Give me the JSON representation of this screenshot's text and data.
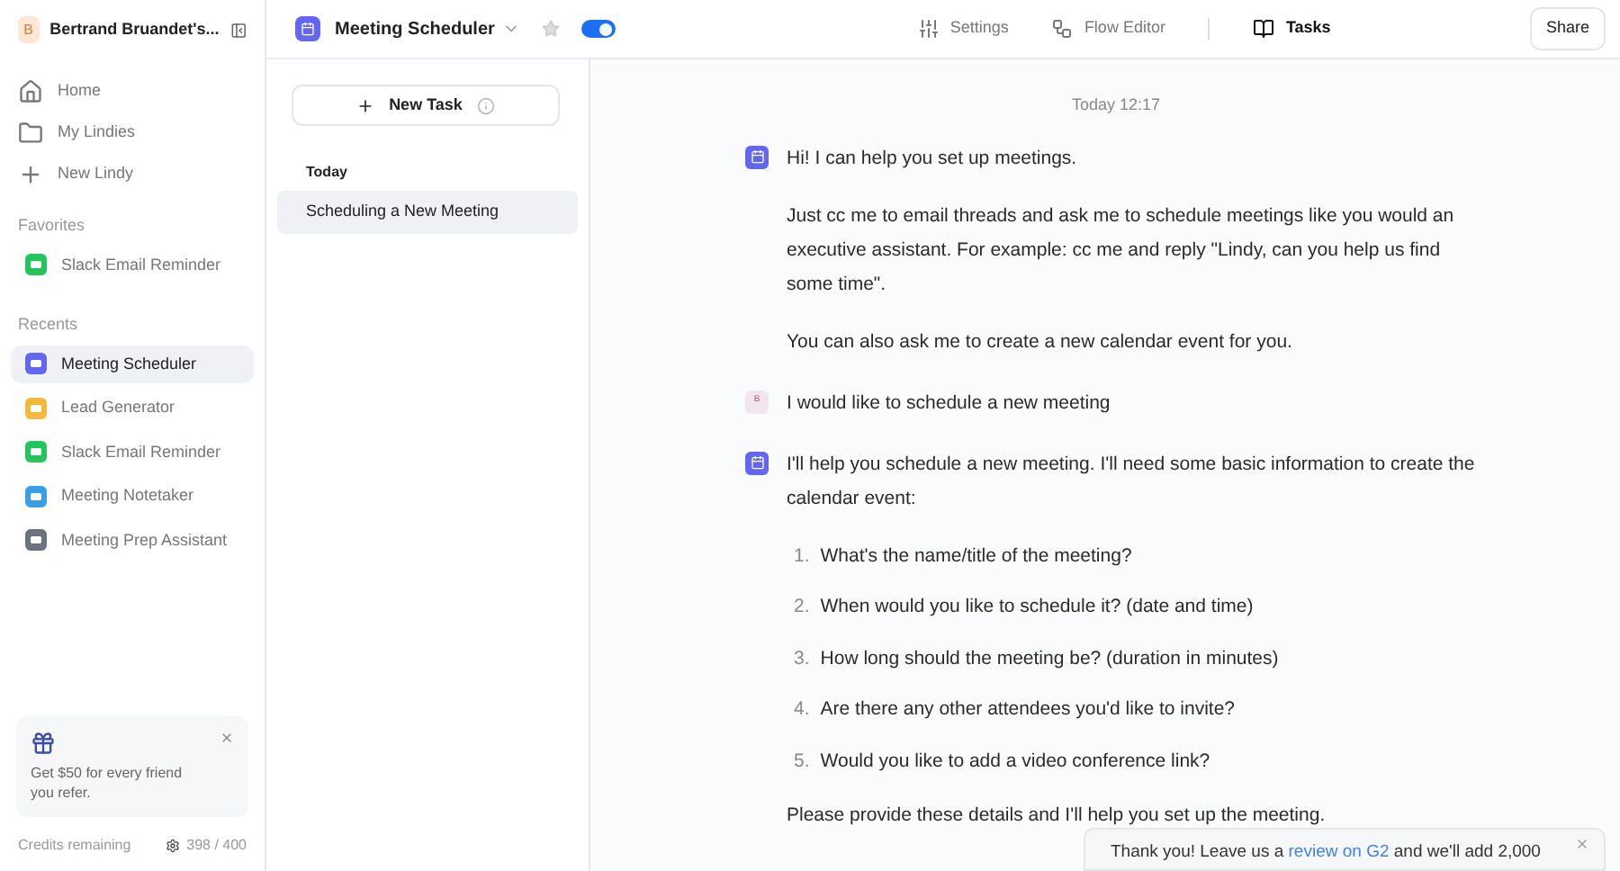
{
  "workspace": {
    "initial": "B",
    "name": "Bertrand Bruandet's..."
  },
  "nav": [
    {
      "kind": "home",
      "label": "Home"
    },
    {
      "kind": "folder",
      "label": "My Lindies"
    },
    {
      "kind": "plus",
      "label": "New Lindy"
    }
  ],
  "favorites": {
    "title": "Favorites",
    "items": [
      {
        "label": "Slack Email Reminder",
        "color": "#22c55e",
        "selected": false
      }
    ]
  },
  "recents": {
    "title": "Recents",
    "items": [
      {
        "label": "Meeting Scheduler",
        "color": "#6366f1",
        "selected": true
      },
      {
        "label": "Lead Generator",
        "color": "#f5b83d",
        "selected": false
      },
      {
        "label": "Slack Email Reminder",
        "color": "#22c55e",
        "selected": false
      },
      {
        "label": "Meeting Notetaker",
        "color": "#3b9fe8",
        "selected": false
      },
      {
        "label": "Meeting Prep Assistant",
        "color": "#6b7280",
        "selected": false
      }
    ]
  },
  "promo": {
    "text": "Get $50 for every friend you refer."
  },
  "credits": {
    "label": "Credits remaining",
    "value": "398 / 400"
  },
  "agent": {
    "name": "Meeting Scheduler",
    "enabled": true
  },
  "tabs": [
    {
      "kind": "settings",
      "label": "Settings",
      "selected": false
    },
    {
      "kind": "flow",
      "label": "Flow Editor",
      "selected": false
    },
    {
      "kind": "tasks",
      "label": "Tasks",
      "selected": true
    }
  ],
  "share": "Share",
  "new_task": "New Task",
  "task_groups": [
    {
      "title": "Today",
      "tasks": [
        {
          "label": "Scheduling a New Meeting",
          "selected": true
        }
      ]
    }
  ],
  "chat": {
    "timestamp": "Today 12:17",
    "messages": [
      {
        "kind": "bot",
        "paragraphs": [
          "Hi! I can help you set up meetings.",
          "Just cc me to email threads and ask me to schedule meetings like you would an executive assistant. For example: cc me and reply \"Lindy, can you help us find some time\".",
          "You can also ask me to create a new calendar event for you."
        ]
      },
      {
        "kind": "user",
        "avatar": "B",
        "paragraphs": [
          "I would like to schedule a new meeting"
        ]
      },
      {
        "kind": "bot",
        "paragraphs": [
          "I'll help you schedule a new meeting. I'll need some basic information to create the calendar event:"
        ],
        "list": [
          {
            "num": "1.",
            "text": "What's the name/title of the meeting?"
          },
          {
            "num": "2.",
            "text": "When would you like to schedule it? (date and time)"
          },
          {
            "num": "3.",
            "text": "How long should the meeting be? (duration in minutes)"
          },
          {
            "num": "4.",
            "text": "Are there any other attendees you'd like to invite?"
          },
          {
            "num": "5.",
            "text": "Would you like to add a video conference link?"
          }
        ],
        "after": "Please provide these details and I'll help you set up the meeting."
      }
    ]
  },
  "toast": {
    "before": "Thank you! Leave us a",
    "link": "review on G2",
    "after": "and we'll add 2,000"
  }
}
